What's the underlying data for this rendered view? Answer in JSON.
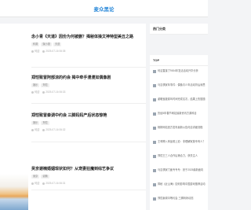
{
  "header": {
    "logo": "麦众黑论"
  },
  "articles": [
    {
      "title": "念小青《天道》因份为何被删？揭秘体操文神特型美丑之路",
      "tags": [
        "科普",
        "娱小报",
        "天道"
      ],
      "author": "何迎",
      "date": "2025-07-16 06:35"
    },
    {
      "title": "郑恺致冒阿部涼的约会 揭中牵手漫漫如偶像剧",
      "tags": [
        "娱乐",
        "郑恺"
      ],
      "author": "何迎",
      "date": "2025-07-16 06:33"
    },
    {
      "title": "郑恺致冒秦调中约会 三脚妈妈产后状态惊艳",
      "tags": [
        "娱乐",
        "郑恺"
      ],
      "author": "何迎",
      "date": "2025-07-16 06:32"
    },
    {
      "title": "吴京谢楠婚姻现状如何？从宠妻狂魔到综艺争议",
      "tags": [
        "吴京",
        "谢楠"
      ],
      "author": "何迎",
      "date": "2025-07-16 06:31"
    }
  ],
  "sidebar": {
    "hot_title": "热门分类",
    "top_title": "TOP",
    "top_items": [
      "何洁直接了9004年复活活动升华分析",
      "马嘉祺家年事件：偶像青少年活动背后深思",
      "谢略宝被原叫时间完成名次，结果上热搜题",
      "历经5年春节网站最新资讯方源科目",
      "杨柳网站官方发布最新公告何洁详细流程",
      "王菲跨入商品看上影：非理解家族专有人？",
      "郑恺王三人合作后第合力，获关注人",
      "马嘉祺家门面专专专：张于2025最新面向",
      "揭秘《近山海》如何影响中国游戏推荐活动",
      "郑恺秦调中等约会 三脚妈妈动态"
    ]
  }
}
